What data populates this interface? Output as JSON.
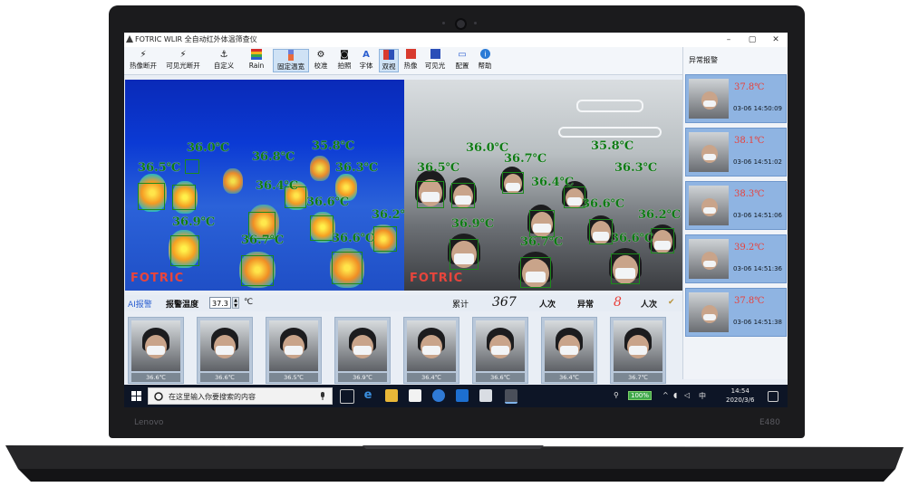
{
  "app": {
    "title": "FOTRIC WLIR 全自动红外体温筛查仪",
    "window_controls": [
      "–",
      "▢",
      "✕"
    ]
  },
  "toolbar": {
    "items": [
      {
        "label": "热像断开",
        "icon": "thermal-disconnect-icon",
        "glyph": "⚡"
      },
      {
        "label": "可见光断开",
        "icon": "visible-disconnect-icon",
        "glyph": "⚡"
      },
      {
        "label": "自定义",
        "icon": "anchor-icon",
        "glyph": "⚓"
      },
      {
        "label": "Rain",
        "icon": "palette-icon",
        "glyph": ""
      },
      {
        "label": "固定温宽",
        "icon": "fixed-range-icon",
        "glyph": "▮"
      },
      {
        "label": "校准",
        "icon": "calibrate-icon",
        "glyph": "⚙"
      },
      {
        "label": "拍照",
        "icon": "camera-icon",
        "glyph": "◙"
      },
      {
        "label": "字体",
        "icon": "font-icon",
        "glyph": "A"
      },
      {
        "label": "双视",
        "icon": "dual-view-icon",
        "glyph": ""
      },
      {
        "label": "热像",
        "icon": "thermal-view-icon",
        "glyph": ""
      },
      {
        "label": "可见光",
        "icon": "visible-view-icon",
        "glyph": ""
      },
      {
        "label": "配置",
        "icon": "config-icon",
        "glyph": "▭"
      },
      {
        "label": "帮助",
        "icon": "help-icon",
        "glyph": "i"
      }
    ]
  },
  "alarm_panel": {
    "title": "异常报警",
    "items": [
      {
        "temp": "37.8℃",
        "time": "03-06 14:50:09"
      },
      {
        "temp": "38.1℃",
        "time": "03-06 14:51:02"
      },
      {
        "temp": "38.3℃",
        "time": "03-06 14:51:06"
      },
      {
        "temp": "39.2℃",
        "time": "03-06 14:51:36"
      },
      {
        "temp": "37.8℃",
        "time": "03-06 14:51:38"
      }
    ]
  },
  "video": {
    "watermark": "FOTRIC",
    "thermal_labels": [
      "36.5℃",
      "36.0℃",
      "36.8℃",
      "35.8℃",
      "36.3℃",
      "36.6℃",
      "36.4℃",
      "36.9℃",
      "36.7℃",
      "36.6℃",
      "36.2℃"
    ],
    "visible_labels": [
      "36.5℃",
      "36.0℃",
      "36.7℃",
      "35.8℃",
      "36.3℃",
      "36.6℃",
      "36.4℃",
      "36.9℃",
      "36.7℃",
      "36.6℃",
      "36.2℃"
    ]
  },
  "status": {
    "ai_alarm": "AI报警",
    "threshold_label": "报警温度",
    "threshold_value": "37.3",
    "unit": "℃",
    "total_label": "累计",
    "total_count": "367",
    "people_unit": "人次",
    "abnormal_label": "异常",
    "abnormal_count": "8"
  },
  "snapshots": [
    "36.6℃",
    "36.6℃",
    "36.5℃",
    "36.9℃",
    "36.4℃",
    "36.6℃",
    "36.4℃",
    "36.7℃"
  ],
  "taskbar": {
    "search_placeholder": "在这里输入你要搜索的内容",
    "battery": "100%",
    "ime": "中",
    "time": "14:54",
    "date": "2020/3/6"
  },
  "laptop": {
    "brand_left": "Lenovo",
    "brand_right": "E480"
  },
  "colors": {
    "alarm_temp": "#e8403a",
    "label_green": "#0e7a14",
    "alarm_item_bg": "#8fb4e2",
    "taskbar_bg": "#0d1526"
  }
}
